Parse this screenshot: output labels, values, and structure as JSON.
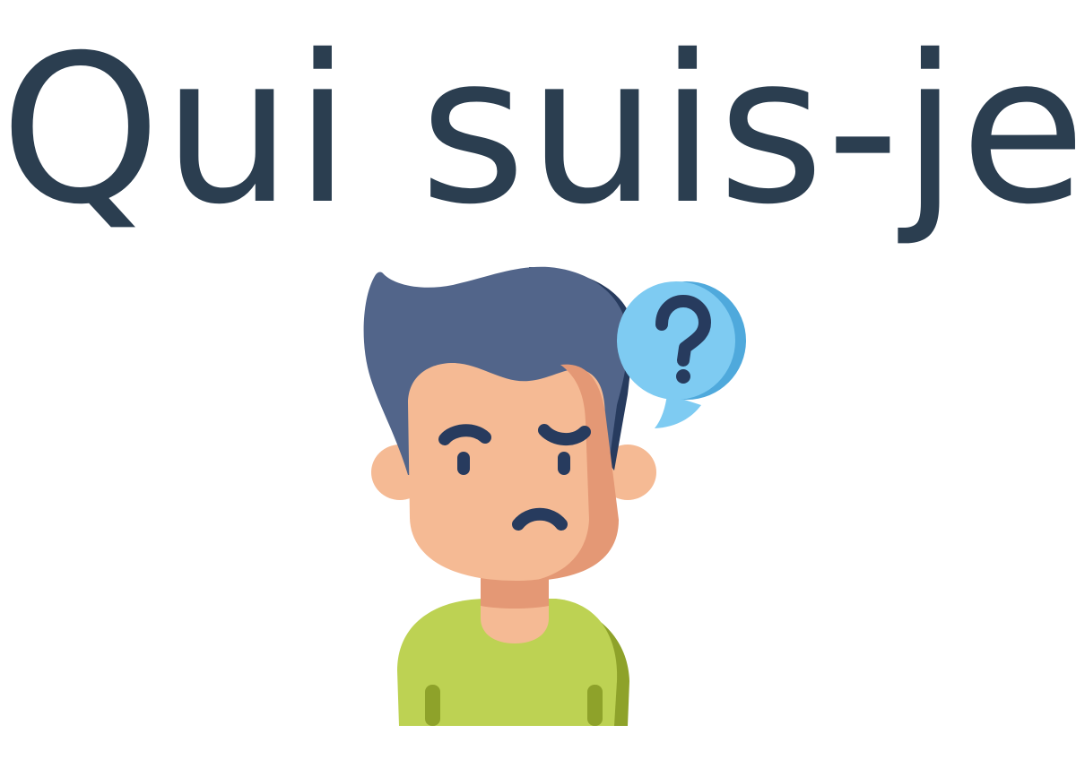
{
  "title": "Qui suis-je",
  "illustration": {
    "name": "confused-man-with-question-bubble",
    "bubble_symbol": "?",
    "colors": {
      "title": "#2b3e50",
      "hair": "#52658a",
      "hair_shadow": "#273b5e",
      "skin": "#f5ba94",
      "skin_shadow": "#e49875",
      "shirt": "#bdd253",
      "shirt_shadow": "#8ea22a",
      "bubble": "#7ecbf2",
      "bubble_shadow": "#4fa9dc",
      "features": "#273b5e"
    }
  }
}
